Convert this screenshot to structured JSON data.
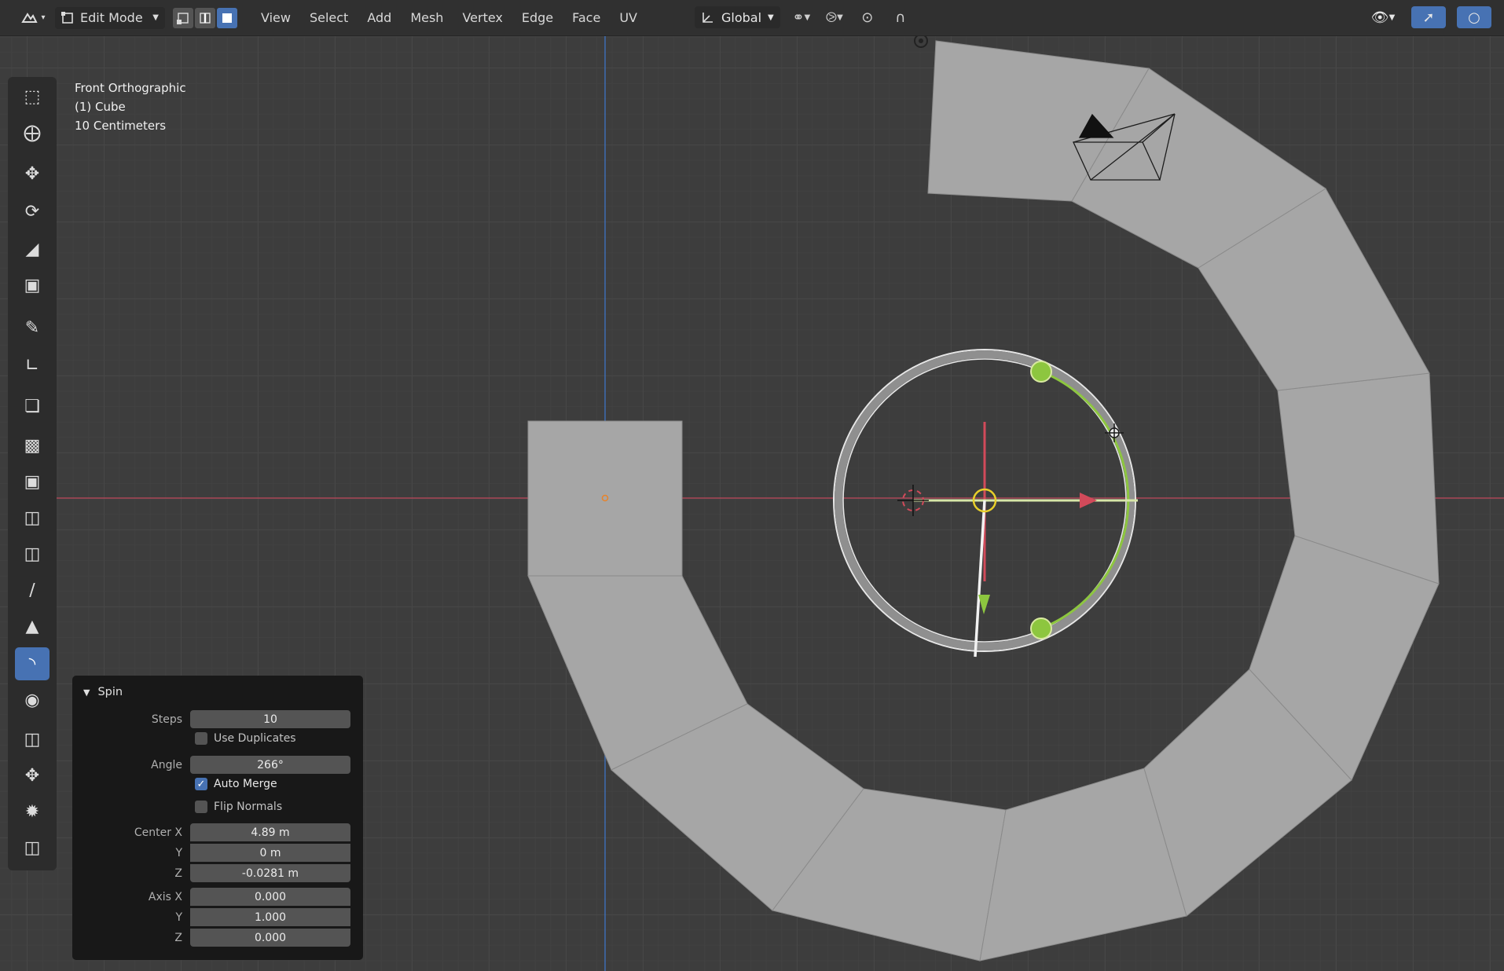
{
  "header": {
    "mode": "Edit Mode",
    "menus": [
      "View",
      "Select",
      "Add",
      "Mesh",
      "Vertex",
      "Edge",
      "Face",
      "UV"
    ],
    "orientation": "Global",
    "icons": {
      "editor_type": "editor-type-icon",
      "vertex_select": "vertex-select-icon",
      "edge_select": "edge-select-icon",
      "face_select": "face-select-icon",
      "pivot": "pivot-icon",
      "snap": "snap-icon",
      "proportional": "proportional-editing-icon",
      "visibility": "object-visibility-icon",
      "gizmo": "gizmo-icon",
      "overlay": "overlay-icon"
    }
  },
  "viewport": {
    "view_name": "Front Orthographic",
    "object_name": "(1) Cube",
    "scale": "10 Centimeters"
  },
  "toolbar": {
    "tools": [
      "select-box-icon",
      "cursor-icon",
      "move-icon",
      "rotate-icon",
      "scale-icon",
      "transform-icon",
      "annotate-icon",
      "measure-icon",
      "add-cube-icon",
      "extrude-icon",
      "inset-icon",
      "bevel-icon",
      "loop-cut-icon",
      "knife-icon",
      "poly-build-icon",
      "spin-icon",
      "smooth-icon",
      "edge-slide-icon",
      "shrink-fatten-icon",
      "shear-icon",
      "rip-icon"
    ],
    "active_tool": "spin-icon"
  },
  "spin_panel": {
    "title": "Spin",
    "steps_label": "Steps",
    "steps": "10",
    "use_duplicates_label": "Use Duplicates",
    "use_duplicates": false,
    "angle_label": "Angle",
    "angle": "266°",
    "auto_merge_label": "Auto Merge",
    "auto_merge": true,
    "flip_normals_label": "Flip Normals",
    "flip_normals": false,
    "center_x_label": "Center X",
    "center_x": "4.89 m",
    "center_y_label": "Y",
    "center_y": "0 m",
    "center_z_label": "Z",
    "center_z": "-0.0281 m",
    "axis_x_label": "Axis X",
    "axis_x": "0.000",
    "axis_y_label": "Y",
    "axis_y": "1.000",
    "axis_z_label": "Z",
    "axis_z": "0.000"
  },
  "colors": {
    "accent": "#4772b3",
    "x_axis": "#b5485a",
    "z_axis": "#3e6fb8",
    "mesh": "#a6a6a6",
    "gizmo_green": "#8dc63f"
  }
}
